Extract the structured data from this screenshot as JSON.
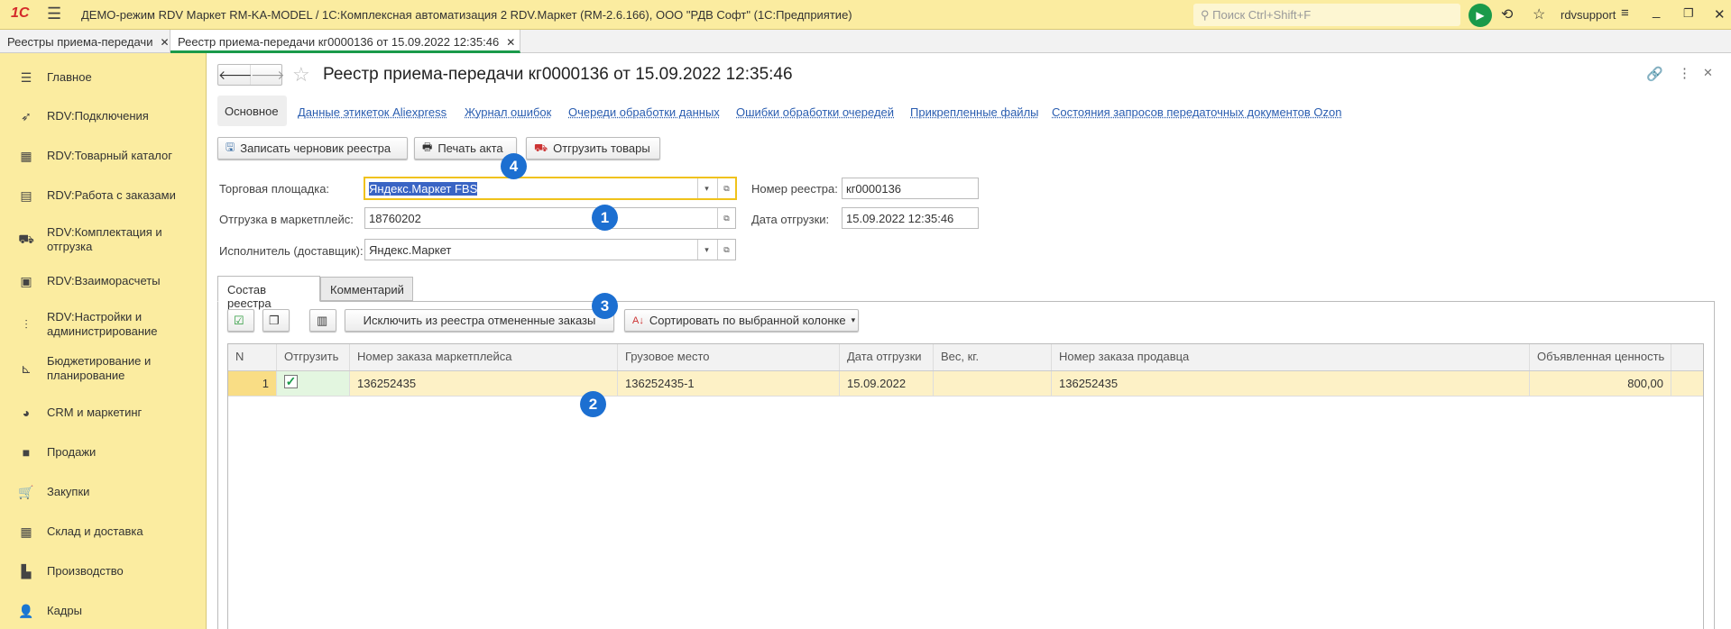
{
  "titlebar": {
    "logo": "1С",
    "title": "ДЕМО-режим RDV Маркет RM-KA-MODEL / 1С:Комплексная автоматизация 2 RDV.Маркет (RM-2.6.166), ООО \"РДВ Софт\"  (1С:Предприятие)",
    "search_placeholder": "Поиск Ctrl+Shift+F",
    "user": "rdvsupport"
  },
  "window_tabs": [
    {
      "label": "Реестры приема-передачи"
    },
    {
      "label": "Реестр приема-передачи кг0000136 от 15.09.2022 12:35:46",
      "active": true
    }
  ],
  "sidebar": {
    "items": [
      {
        "label": "Главное",
        "icon": "menu-lines-icon"
      },
      {
        "label": "RDV:Подключения",
        "icon": "rocket-icon"
      },
      {
        "label": "RDV:Товарный каталог",
        "icon": "catalog-grid-icon"
      },
      {
        "label": "RDV:Работа с заказами",
        "icon": "orders-icon"
      },
      {
        "label": "RDV:Комплектация и отгрузка",
        "icon": "cart-box-icon"
      },
      {
        "label": "RDV:Взаиморасчеты",
        "icon": "calculator-icon"
      },
      {
        "label": "RDV:Настройки и администрирование",
        "icon": "sliders-icon"
      },
      {
        "label": "Бюджетирование и планирование",
        "icon": "budget-chart-icon"
      },
      {
        "label": "CRM и маркетинг",
        "icon": "pie-chart-icon"
      },
      {
        "label": "Продажи",
        "icon": "bag-icon"
      },
      {
        "label": "Закупки",
        "icon": "cart-icon"
      },
      {
        "label": "Склад и доставка",
        "icon": "warehouse-icon"
      },
      {
        "label": "Производство",
        "icon": "factory-icon"
      },
      {
        "label": "Кадры",
        "icon": "person-icon"
      }
    ]
  },
  "form": {
    "title": "Реестр приема-передачи кг0000136 от 15.09.2022 12:35:46",
    "nav": [
      "Основное",
      "Данные этикеток Aliexpress",
      "Журнал ошибок",
      "Очереди обработки данных",
      "Ошибки обработки очередей",
      "Прикрепленные файлы",
      "Состояния запросов передаточных документов Ozon"
    ],
    "buttons": {
      "save_draft": "Записать черновик реестра",
      "print": "Печать акта",
      "ship": "Отгрузить товары"
    },
    "fields": {
      "marketplace_label": "Торговая площадка:",
      "marketplace": "Яндекс.Маркет FBS",
      "shipment_label": "Отгрузка в маркетплейс:",
      "shipment": "18760202",
      "carrier_label": "Исполнитель (доставщик):",
      "carrier": "Яндекс.Маркет",
      "number_label": "Номер реестра:",
      "number": "кг0000136",
      "date_label": "Дата отгрузки:",
      "date": "15.09.2022 12:35:46"
    },
    "tabs": [
      "Состав реестра",
      "Комментарий"
    ],
    "table_toolbar": {
      "exclude": "Исключить из реестра отмененные заказы",
      "sort": "Сортировать по выбранной колонке"
    },
    "table": {
      "columns": [
        "N",
        "Отгрузить",
        "Номер заказа маркетплейса",
        "Грузовое место",
        "Дата отгрузки",
        "Вес, кг.",
        "Номер заказа продавца",
        "Объявленная ценность"
      ],
      "rows": [
        {
          "n": "1",
          "ship": true,
          "mp_order": "136252435",
          "cargo": "136252435-1",
          "date": "15.09.2022",
          "weight": "",
          "seller_order": "136252435",
          "value": "800,00"
        }
      ]
    },
    "badges": [
      "1",
      "2",
      "3",
      "4"
    ]
  },
  "colors": {
    "titlebar": "#fbeca0",
    "accent_green": "#1a9a4a",
    "link": "#2a5db0",
    "badge": "#1c6fd1",
    "row_selected": "#fdf1c6"
  }
}
